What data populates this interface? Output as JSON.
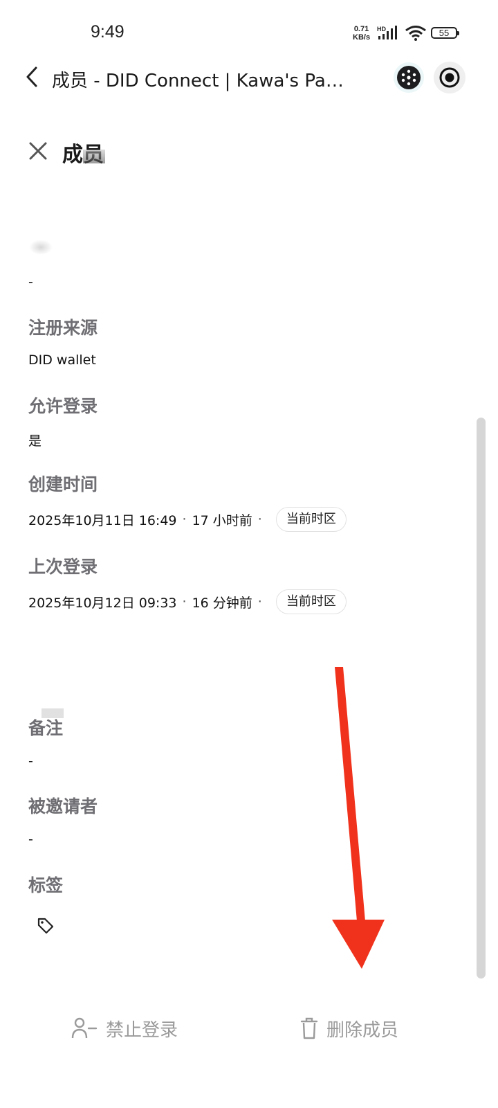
{
  "status_bar": {
    "time": "9:49",
    "net_speed_value": "0.71",
    "net_speed_unit": "KB/s",
    "signal_label": "HD",
    "battery": "55"
  },
  "nav": {
    "title": "成员 - DID Connect | Kawa's Pay..."
  },
  "page": {
    "title": "成员"
  },
  "fields": {
    "blurred_value": "-",
    "register_source_label": "注册来源",
    "register_source_value": "DID wallet",
    "allow_login_label": "允许登录",
    "allow_login_value": "是",
    "created_label": "创建时间",
    "created_date": "2025年10月11日 16:49",
    "created_relative": "17 小时前",
    "last_login_label": "上次登录",
    "last_login_date": "2025年10月12日 09:33",
    "last_login_relative": "16 分钟前",
    "timezone_badge": "当前时区",
    "separator": "·",
    "remark_label": "备注",
    "remark_value": "-",
    "inviter_label": "被邀请者",
    "inviter_value": "-",
    "tags_label": "标签"
  },
  "actions": {
    "ban_login": "禁止登录",
    "delete_member": "删除成员"
  },
  "colors": {
    "label_gray": "#6e6e73",
    "action_gray": "#9a9a9a",
    "arrow_red": "#f0321c"
  },
  "icons": [
    "back-arrow-icon",
    "mini-program-icon",
    "record-icon",
    "close-icon",
    "tag-icon",
    "user-minus-icon",
    "trash-icon",
    "wifi-icon",
    "signal-icon"
  ]
}
